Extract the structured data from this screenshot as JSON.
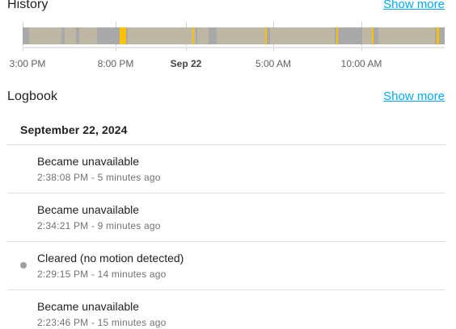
{
  "history": {
    "title": "History",
    "show_more": "Show more",
    "axis_labels": [
      {
        "text": "3:00 PM",
        "bold": false
      },
      {
        "text": "8:00 PM",
        "bold": false
      },
      {
        "text": "Sep 22",
        "bold": true
      },
      {
        "text": "5:00 AM",
        "bold": false
      },
      {
        "text": "10:00 AM",
        "bold": false
      }
    ],
    "colors": {
      "unavailable": "#a9a9a9",
      "clear": "#bdb7a4",
      "detected": "#ffc107"
    }
  },
  "logbook": {
    "title": "Logbook",
    "show_more": "Show more",
    "date": "September 22, 2024",
    "entries": [
      {
        "message": "Became unavailable",
        "time": "2:38:08 PM - 5 minutes ago",
        "dot": false
      },
      {
        "message": "Became unavailable",
        "time": "2:34:21 PM - 9 minutes ago",
        "dot": false
      },
      {
        "message": "Cleared (no motion detected)",
        "time": "2:29:15 PM - 14 minutes ago",
        "dot": true
      },
      {
        "message": "Became unavailable",
        "time": "2:23:46 PM - 15 minutes ago",
        "dot": false
      }
    ]
  }
}
